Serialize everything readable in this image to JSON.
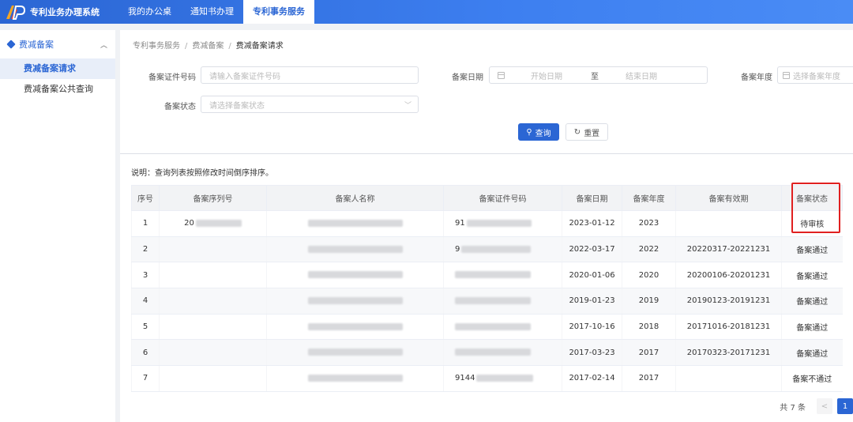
{
  "app": {
    "title": "专利业务办理系统"
  },
  "nav": {
    "items": [
      {
        "label": "我的办公桌"
      },
      {
        "label": "通知书办理"
      },
      {
        "label": "专利事务服务"
      }
    ]
  },
  "sidebar": {
    "group_label": "费减备案",
    "items": [
      {
        "label": "费减备案请求"
      },
      {
        "label": "费减备案公共查询"
      }
    ]
  },
  "breadcrumb": [
    "专利事务服务",
    "费减备案",
    "费减备案请求"
  ],
  "form": {
    "cert_label": "备案证件号码",
    "cert_placeholder": "请输入备案证件号码",
    "date_label": "备案日期",
    "date_start": "开始日期",
    "date_to": "至",
    "date_end": "结束日期",
    "year_label": "备案年度",
    "year_placeholder": "选择备案年度",
    "status_label": "备案状态",
    "status_placeholder": "请选择备案状态",
    "query_label": "查询",
    "reset_label": "重置"
  },
  "note": "说明：查询列表按照修改时间倒序排序。",
  "table": {
    "headers": [
      "序号",
      "备案序列号",
      "备案人名称",
      "备案证件号码",
      "备案日期",
      "备案年度",
      "备案有效期",
      "备案状态"
    ],
    "rows": [
      {
        "idx": "1",
        "serial": "20",
        "name": "",
        "cert": "91",
        "date": "2023-01-12",
        "year": "2023",
        "valid": "",
        "status": "待审核"
      },
      {
        "idx": "2",
        "serial": "",
        "name": "",
        "cert": "9",
        "date": "2022-03-17",
        "year": "2022",
        "valid": "20220317-20221231",
        "status": "备案通过"
      },
      {
        "idx": "3",
        "serial": "",
        "name": "",
        "cert": "",
        "date": "2020-01-06",
        "year": "2020",
        "valid": "20200106-20201231",
        "status": "备案通过"
      },
      {
        "idx": "4",
        "serial": "",
        "name": "",
        "cert": "",
        "date": "2019-01-23",
        "year": "2019",
        "valid": "20190123-20191231",
        "status": "备案通过"
      },
      {
        "idx": "5",
        "serial": "",
        "name": "",
        "cert": "",
        "date": "2017-10-16",
        "year": "2018",
        "valid": "20171016-20181231",
        "status": "备案通过"
      },
      {
        "idx": "6",
        "serial": "",
        "name": "",
        "cert": "",
        "date": "2017-03-23",
        "year": "2017",
        "valid": "20170323-20171231",
        "status": "备案通过"
      },
      {
        "idx": "7",
        "serial": "",
        "name": "",
        "cert": "9144",
        "date": "2017-02-14",
        "year": "2017",
        "valid": "",
        "status": "备案不通过"
      }
    ]
  },
  "pager": {
    "total": "共 7 条",
    "current": "1",
    "prev": "<"
  },
  "colors": {
    "primary": "#2b66d4",
    "highlight": "#e02020"
  }
}
